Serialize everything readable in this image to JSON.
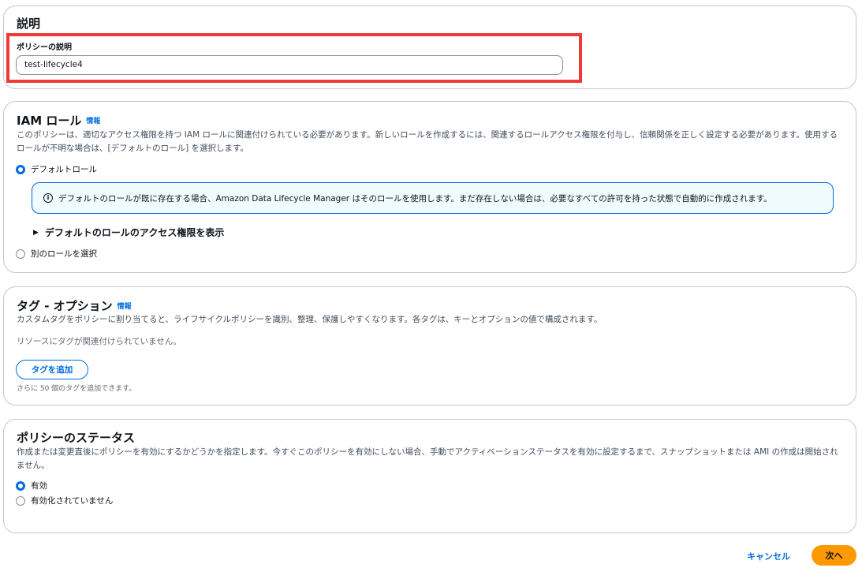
{
  "description_section": {
    "heading": "説明",
    "field_label": "ポリシーの説明",
    "field_value": "test-lifecycle4"
  },
  "iam_section": {
    "heading": "IAM ロール",
    "info_link": "情報",
    "description": "このポリシーは、適切なアクセス権限を持つ IAM ロールに関連付けられている必要があります。新しいロールを作成するには、関連するロールアクセス権限を付与し、信頼関係を正しく設定する必要があります。使用するロールが不明な場合は、[デフォルトのロール] を選択します。",
    "radio_default_label": "デフォルトロール",
    "alert_text": "デフォルトのロールが既に存在する場合、Amazon Data Lifecycle Manager はそのロールを使用します。まだ存在しない場合は、必要なすべての許可を持った状態で自動的に作成されます。",
    "expander_label": "デフォルトのロールのアクセス権限を表示",
    "radio_other_label": "別のロールを選択"
  },
  "tags_section": {
    "heading": "タグ - オプション",
    "info_link": "情報",
    "description": "カスタムタグをポリシーに割り当てると、ライフサイクルポリシーを識別、整理、保護しやすくなります。各タグは、キーとオプションの値で構成されます。",
    "empty_text": "リソースにタグが関連付けられていません。",
    "add_button": "タグを追加",
    "limit_text": "さらに 50 個のタグを追加できます。"
  },
  "status_section": {
    "heading": "ポリシーのステータス",
    "description": "作成または変更直後にポリシーを有効にするかどうかを指定します。今すぐこのポリシーを有効にしない場合、手動でアクティベーションステータスを有効に設定するまで、スナップショットまたは AMI の作成は開始されません。",
    "radio_enabled_label": "有効",
    "radio_disabled_label": "有効化されていません"
  },
  "footer": {
    "cancel_label": "キャンセル",
    "next_label": "次へ"
  },
  "colors": {
    "primary": "#ff9900",
    "link": "#006ce0",
    "highlight": "#f03a3a",
    "alert_bg": "#f0fbff"
  }
}
